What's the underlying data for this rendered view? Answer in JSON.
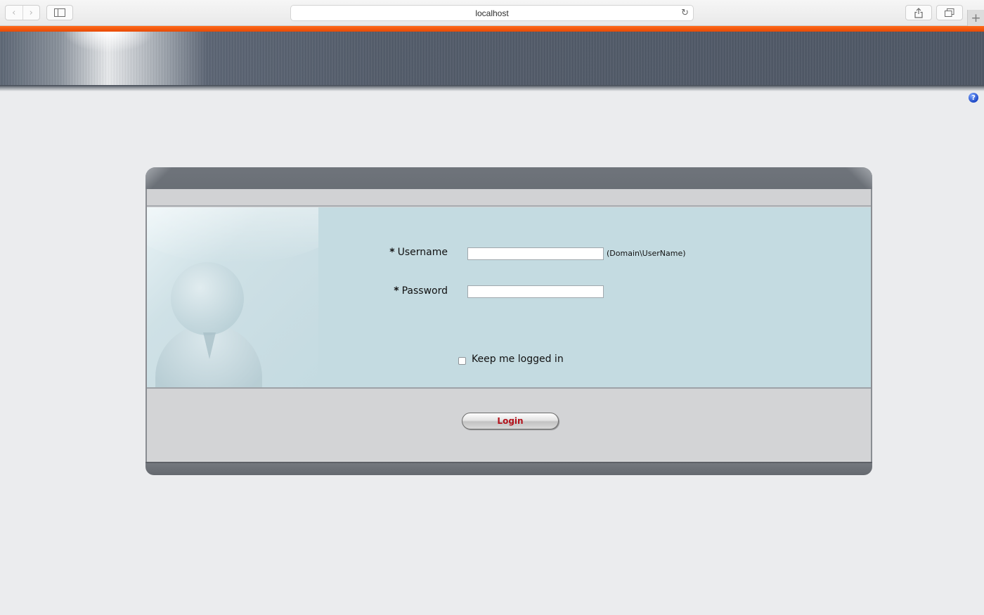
{
  "browser": {
    "url": "localhost",
    "icons": {
      "back": "chevron-left-icon",
      "forward": "chevron-right-icon",
      "sidebar": "sidebar-icon",
      "reload": "reload-icon",
      "share": "share-icon",
      "tabs": "tabs-icon",
      "new_tab": "plus-icon"
    }
  },
  "page": {
    "accent_color": "#f25a0c",
    "help_icon": "question-mark-icon"
  },
  "login_form": {
    "username_label": "Username",
    "password_label": "Password",
    "required_marker": "*",
    "username_value": "",
    "password_value": "",
    "username_hint": "(Domain\\UserName)",
    "keep_logged_in_label": "Keep me logged in",
    "keep_logged_in_checked": false,
    "login_button_label": "Login",
    "login_button_color": "#b3121b"
  }
}
